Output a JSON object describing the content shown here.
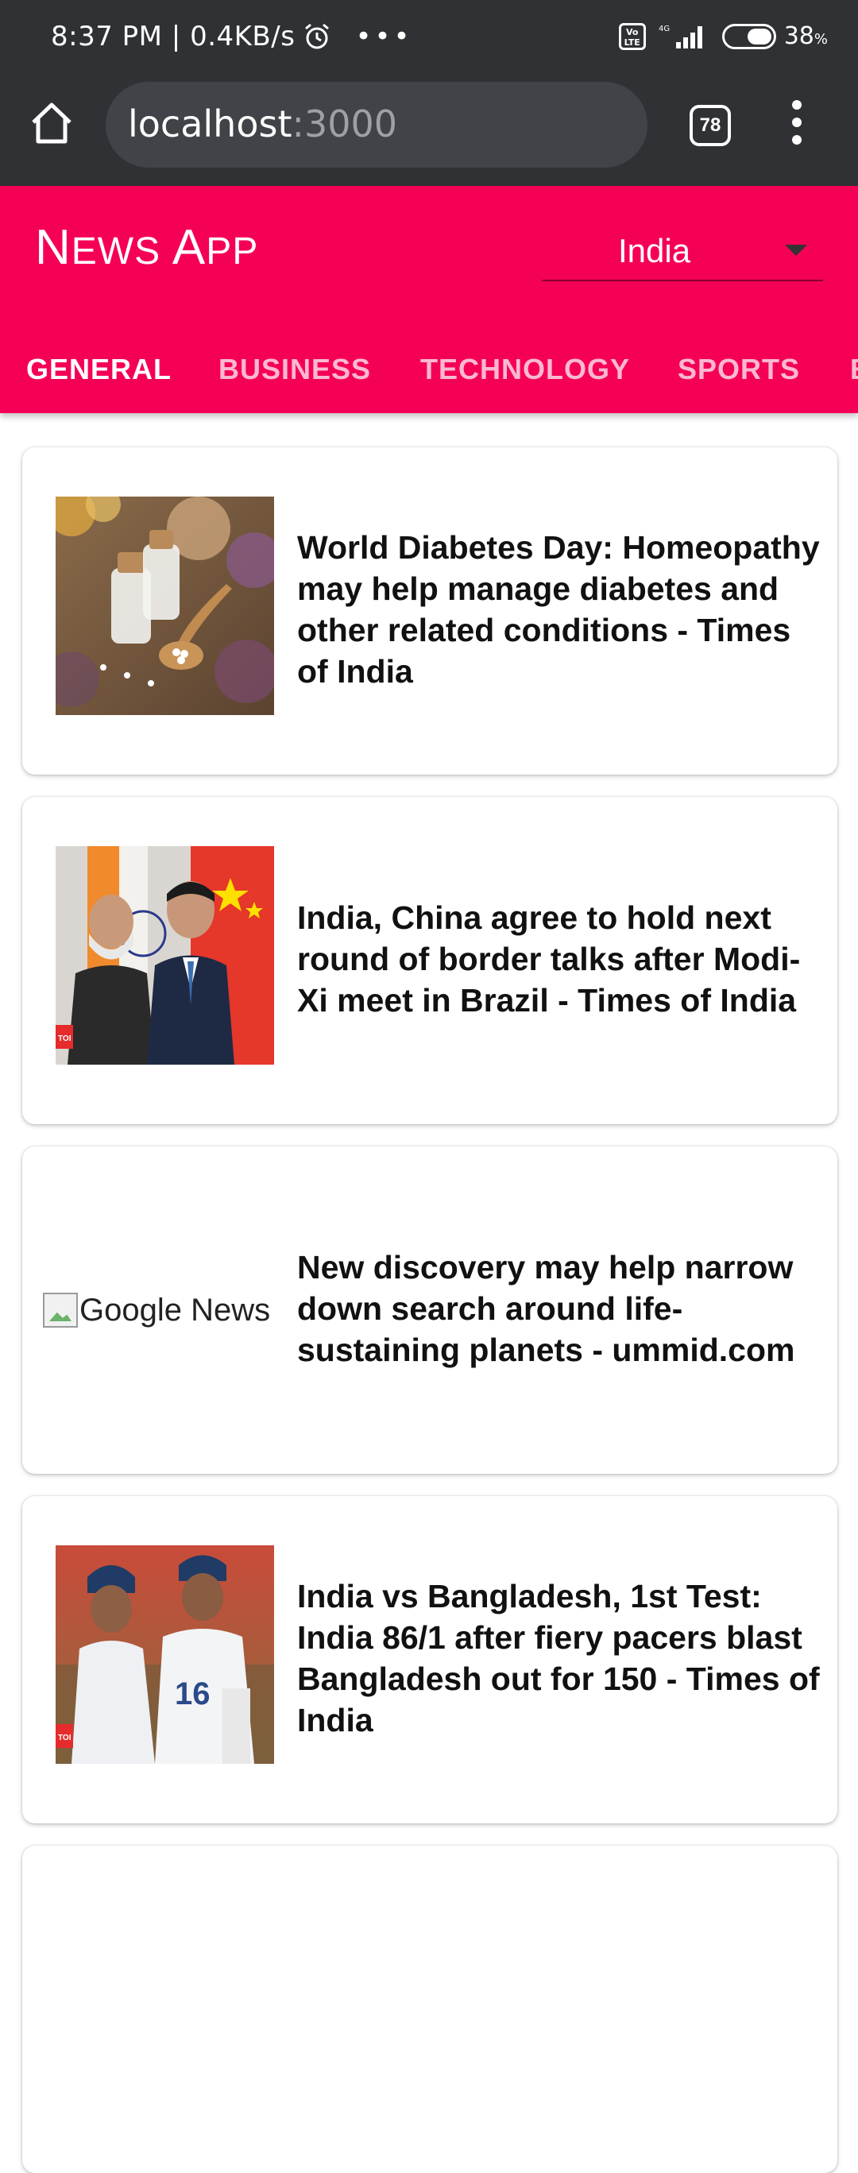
{
  "status_bar": {
    "time": "8:37 PM | 0.4KB/s",
    "battery_percent": "38",
    "battery_unit": "%",
    "network": "4G",
    "volte": "Vo LTE"
  },
  "browser": {
    "url_host": "localhost",
    "url_port": ":3000",
    "tab_count": "78"
  },
  "app": {
    "title": "News App",
    "country_selected": "India",
    "tabs": [
      "GENERAL",
      "BUSINESS",
      "TECHNOLOGY",
      "SPORTS",
      "ENTERTAINMENT"
    ],
    "active_tab": "GENERAL"
  },
  "articles": [
    {
      "headline": "World Diabetes Day: Homeopathy may help manage diabetes and other related conditions - Times of India"
    },
    {
      "headline": "India, China agree to hold next round of border talks after Modi-Xi meet in Brazil - Times of India"
    },
    {
      "headline": "New discovery may help narrow down search around life-sustaining planets - ummid.com",
      "image_alt": "Google News"
    },
    {
      "headline": "India vs Bangladesh, 1st Test: India 86/1 after fiery pacers blast Bangladesh out for 150 - Times of India"
    }
  ],
  "colors": {
    "accent": "#f50057",
    "chrome": "#2f3134"
  }
}
